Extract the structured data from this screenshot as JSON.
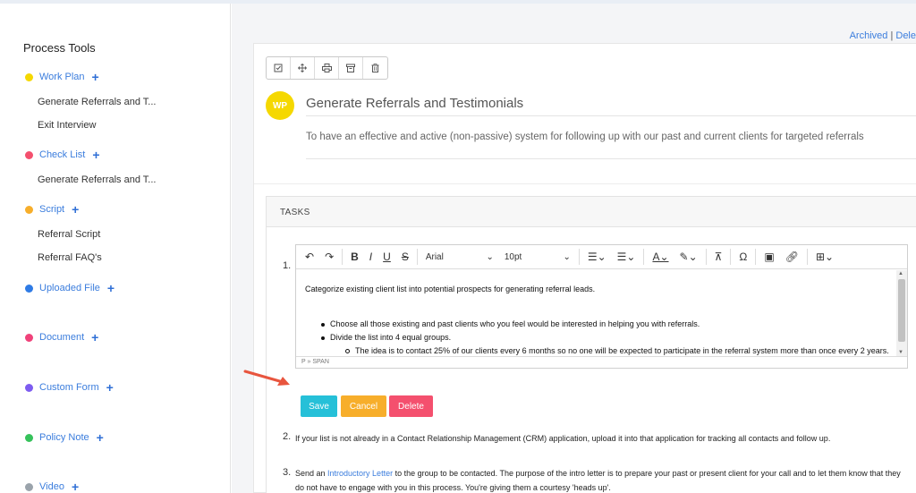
{
  "sidebar": {
    "title": "Process Tools",
    "categories": [
      {
        "label": "Work Plan",
        "color": "#f5d800",
        "items": [
          "Generate Referrals and T...",
          "Exit Interview"
        ]
      },
      {
        "label": "Check List",
        "color": "#f4506e",
        "items": [
          "Generate Referrals and T..."
        ]
      },
      {
        "label": "Script",
        "color": "#f7ae2b",
        "items": [
          "Referral Script",
          "Referral FAQ's"
        ]
      },
      {
        "label": "Uploaded File",
        "color": "#2f7be5",
        "items": []
      },
      {
        "label": "Document",
        "color": "#f0427a",
        "items": []
      },
      {
        "label": "Custom Form",
        "color": "#7d5cf0",
        "items": []
      },
      {
        "label": "Policy Note",
        "color": "#36c25b",
        "items": []
      },
      {
        "label": "Video",
        "color": "#9aa3ab",
        "items": []
      }
    ],
    "plus": "+"
  },
  "toplinks": {
    "archived": "Archived",
    "separator": "|",
    "delete": "Dele"
  },
  "doc": {
    "avatar": "WP",
    "title": "Generate Referrals and Testimonials",
    "description": "To have an effective and active (non-passive) system for following up with our past and current clients for targeted referrals"
  },
  "tasks": {
    "header": "TASKS",
    "task1_number": "1.",
    "editor": {
      "font": "Arial",
      "size": "10pt",
      "paragraph": "Categorize existing client list into potential prospects for generating referral leads.",
      "bullet1": "Choose all those existing and past clients who you feel would be interested in helping you with referrals.",
      "bullet2": "Divide the list into 4 equal groups.",
      "sub_bullet": "The idea is to contact 25% of our clients every 6 months so no one will be expected to participate in the referral system more than once every 2 years.",
      "status": "P » SPAN"
    },
    "buttons": {
      "save": "Save",
      "cancel": "Cancel",
      "delete": "Delete"
    },
    "task2_number": "2.",
    "task2_text": "If your list is not already in a Contact Relationship Management (CRM) application, upload it into that application for tracking all contacts and follow up.",
    "task3_number": "3.",
    "task3_pre": "Send an ",
    "task3_link": "Introductory Letter",
    "task3_post": " to the group to be contacted. The purpose of the intro letter is to prepare your past or present client for your call and to let them know that they",
    "task3_line2": "do not have to engage with you in this process. You're giving them a courtesy 'heads up'."
  },
  "colors": {
    "accent": "#3b7ddd",
    "save": "#26c0d8",
    "cancel": "#f7ae2b",
    "delete": "#f4506e",
    "arrow": "#e8553e"
  }
}
